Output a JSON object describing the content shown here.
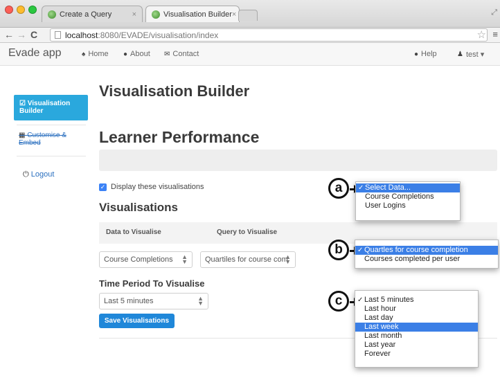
{
  "browser": {
    "tabs": [
      {
        "title": "Create a Query",
        "close": "×"
      },
      {
        "title": "Visualisation Builder",
        "close": "×"
      }
    ],
    "url_host": "localhost",
    "url_path": ":8080/EVADE/visualisation/index",
    "nav": {
      "back": "←",
      "forward": "→",
      "reload": "C"
    },
    "star": "☆",
    "menu": "≡",
    "corner": "⤢"
  },
  "navbar": {
    "brand": "Evade app",
    "links": [
      {
        "label": "Home",
        "icon": "home-icon",
        "glyph": "♠"
      },
      {
        "label": "About",
        "icon": "info-icon",
        "glyph": "●"
      },
      {
        "label": "Contact",
        "icon": "envelope-icon",
        "glyph": "✉"
      }
    ],
    "help": {
      "label": "Help",
      "glyph": "●"
    },
    "user": {
      "label": "test ▾",
      "glyph": "♟"
    }
  },
  "sidebar": {
    "active_icon": "☑",
    "active_label": "Visualisation Builder",
    "customise_icon": "▦",
    "customise_label": "Customise & Embed",
    "logout_icon": "⏻",
    "logout_label": "Logout"
  },
  "main": {
    "title": "Visualisation Builder",
    "subtitle": "Learner Performance",
    "display_checkbox_label": "Display these visualisations",
    "checkbox_checked": true,
    "visualisations_heading": "Visualisations",
    "table_headers": [
      "Data to Visualise",
      "Query to Visualise"
    ],
    "data_select_value": "Course Completions",
    "query_select_value": "Quartiles for course com",
    "time_period_heading": "Time Period To Visualise",
    "time_select_value": "Last 5 minutes",
    "save_button": "Save Visualisations",
    "partial_text": "ise"
  },
  "overlays": {
    "a": {
      "label": "a",
      "options": [
        "Select Data...",
        "Course Completions",
        "User Logins"
      ],
      "checked": 0,
      "highlighted": 0
    },
    "b": {
      "label": "b",
      "options": [
        "Quartles for course completion",
        "Courses completed per user"
      ],
      "checked": 0,
      "highlighted": 0
    },
    "c": {
      "label": "c",
      "options": [
        "Last 5 minutes",
        "Last hour",
        "Last day",
        "Last week",
        "Last month",
        "Last year",
        "Forever"
      ],
      "checked": 0,
      "highlighted": 3
    }
  },
  "colors": {
    "accent": "#2aa8dd",
    "button": "#1f87d9",
    "highlight": "#3b7fe6"
  }
}
